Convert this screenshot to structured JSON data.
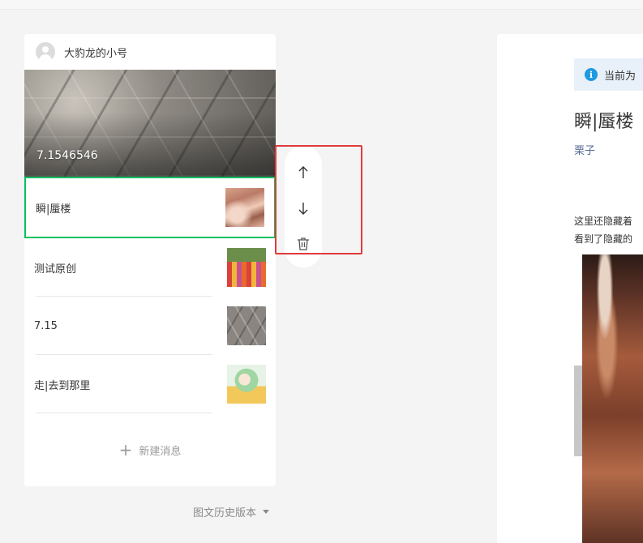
{
  "account": {
    "name": "大豹龙的小号"
  },
  "cover": {
    "title": "7.1546546"
  },
  "items": [
    {
      "title": "瞬|蜃楼",
      "thumb": "sand-dune-thumbnail"
    },
    {
      "title": "测试原创",
      "thumb": "flower-field-thumbnail"
    },
    {
      "title": "7.15",
      "thumb": "ceiling-thumbnail"
    },
    {
      "title": "走|去到那里",
      "thumb": "anime-girl-thumbnail"
    }
  ],
  "new_message": {
    "label": "新建消息"
  },
  "history": {
    "label": "图文历史版本"
  },
  "toolbar": {
    "icons": [
      "arrow-up-icon",
      "arrow-down-icon",
      "trash-icon"
    ]
  },
  "preview": {
    "notice": "当前为",
    "title": "瞬|蜃楼",
    "author": "栗子",
    "body_lines": [
      "这里还隐藏着",
      "看到了隐藏的"
    ]
  },
  "colors": {
    "selected_border": "#07c160",
    "highlight": "#e03b3b",
    "info": "#1e9ae0",
    "author": "#576b95"
  }
}
